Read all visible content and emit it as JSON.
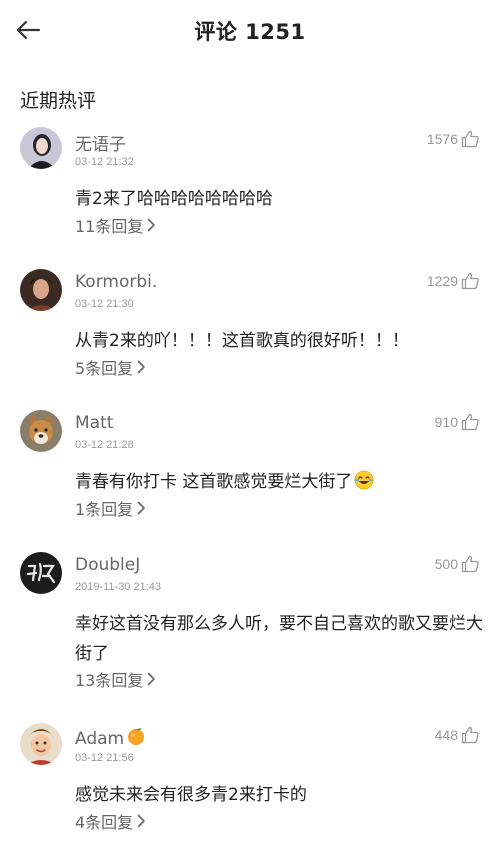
{
  "header": {
    "title": "评论 1251"
  },
  "section": {
    "title": "近期热评"
  },
  "comments": [
    {
      "username": "无语子",
      "time": "03-12 21:32",
      "likes": "1576",
      "text": "青2来了哈哈哈哈哈哈哈哈",
      "replies": "11条回复"
    },
    {
      "username": "Kormorbi.",
      "time": "03-12 21:30",
      "likes": "1229",
      "text": "从青2来的吖！！！这首歌真的很好听！！！",
      "replies": "5条回复"
    },
    {
      "username": "Matt",
      "time": "03-12 21:28",
      "likes": "910",
      "text": "青春有你打卡 这首歌感觉要烂大街了",
      "replies": "1条回复"
    },
    {
      "username": "DoubleJ",
      "time": "2019-11-30 21:43",
      "likes": "500",
      "text": "幸好这首没有那么多人听，要不自己喜欢的歌又要烂大街了",
      "replies": "13条回复"
    },
    {
      "username": "Adam",
      "time": "03-12 21:56",
      "likes": "448",
      "text": "感觉未来会有很多青2来打卡的",
      "replies": "4条回复"
    }
  ],
  "icons": {
    "back": "back-arrow-icon",
    "like": "thumbs-up-icon",
    "chevron": "chevron-right-icon",
    "laugh_emoji": "tears-of-joy-emoji",
    "orange_emoji": "tangerine-emoji"
  }
}
